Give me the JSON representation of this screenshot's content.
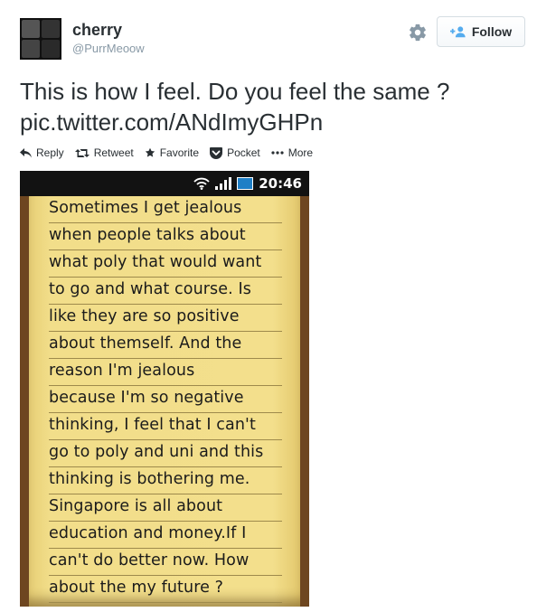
{
  "user": {
    "name": "cherry",
    "handle": "@PurrMeoow"
  },
  "follow_label": "Follow",
  "tweet": {
    "line1": "This is how I feel. Do you feel the same ?",
    "line2": "pic.twitter.com/ANdImyGHPn"
  },
  "actions": {
    "reply": "Reply",
    "retweet": "Retweet",
    "favorite": "Favorite",
    "pocket": "Pocket",
    "more": "More"
  },
  "photo": {
    "status_time": "20:46",
    "note_lines": [
      "Sometimes I get jealous",
      "when people talks about",
      "what poly that would want",
      "to go and what course. Is",
      "like they are so positive",
      "about themself. And the",
      "reason I'm jealous",
      "because I'm so negative",
      "thinking, I feel that I can't",
      "go to poly and uni and this",
      "thinking is bothering me.",
      "Singapore is all about",
      "education and money.If I",
      "can't do better now. How",
      "about the my future ?"
    ]
  },
  "icons": {
    "settings": "gear-icon",
    "follow": "add-user-icon",
    "reply": "reply-icon",
    "retweet": "retweet-icon",
    "favorite": "star-icon",
    "pocket": "pocket-icon",
    "more": "more-dots-icon"
  },
  "colors": {
    "text": "#292f33",
    "muted": "#8899a6",
    "follow_icon": "#55acee",
    "note": "#f3df8c"
  }
}
